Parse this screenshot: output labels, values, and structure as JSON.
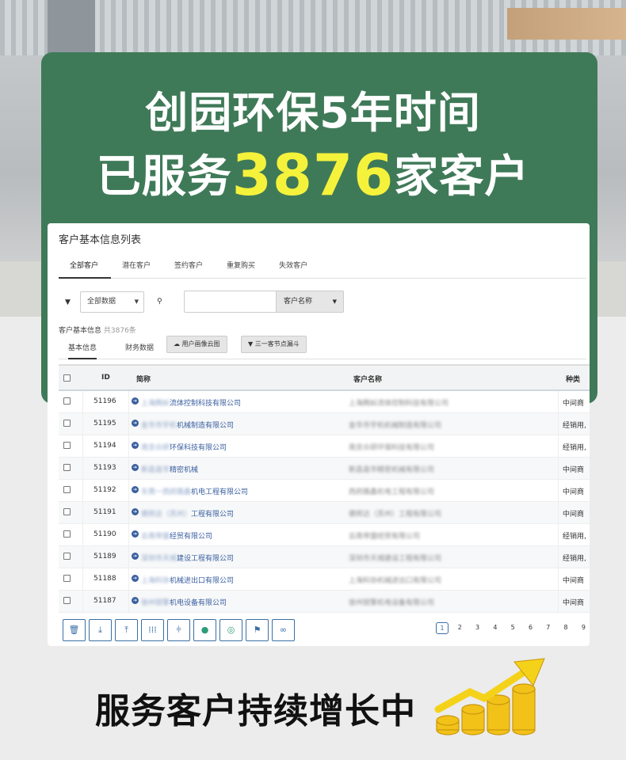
{
  "headline": {
    "line1": "创园环保5年时间",
    "line2_prefix": "已服务",
    "line2_number": "3876",
    "line2_suffix": "家客户"
  },
  "panel": {
    "title": "客户基本信息列表",
    "tabs": [
      "全部客户",
      "潜在客户",
      "签约客户",
      "重复购买",
      "失效客户"
    ],
    "active_tab": "全部客户",
    "filter": {
      "select_value": "全部数据",
      "search_placeholder": "",
      "search_field": "客户名称"
    },
    "info_label": "客户基本信息",
    "info_count": "共3876条",
    "subtabs": [
      "基本信息",
      "财务数据"
    ],
    "buttons": [
      "用户画像云图",
      "三一客节点漏斗"
    ],
    "table": {
      "headers": [
        "ID",
        "简称",
        "客户名称",
        "种类"
      ],
      "rows": [
        {
          "id": "51196",
          "short_blur": "上海腾蚪",
          "short": "流体控制科技有限公司",
          "full": "上海腾蚪流体控制科技有限公司",
          "type": "中间商"
        },
        {
          "id": "51195",
          "short_blur": "金华市宇机",
          "short": "机械制造有限公司",
          "full": "金华市宇机机械制造有限公司",
          "type": "经销用,"
        },
        {
          "id": "51194",
          "short_blur": "南京众研",
          "short": "环保科技有限公司",
          "full": "南京众研环保科技有限公司",
          "type": "经销用,"
        },
        {
          "id": "51193",
          "short_blur": "新昌县华",
          "short": "精密机械",
          "full": "新昌县华精密机械有限公司",
          "type": "中间商"
        },
        {
          "id": "51192",
          "short_blur": "东莞一西府路鑫",
          "short": "机电工程有限公司",
          "full": "西府路鑫机电工程有限公司",
          "type": "中间商"
        },
        {
          "id": "51191",
          "short_blur": "德邦达（苏州）",
          "short": "工程有限公司",
          "full": "德邦达（苏州）工程有限公司",
          "type": "中间商"
        },
        {
          "id": "51190",
          "short_blur": "云南帝盟",
          "short": "经贸有限公司",
          "full": "云南帝盟经贸有限公司",
          "type": "经销用,"
        },
        {
          "id": "51189",
          "short_blur": "深圳市天城",
          "short": "建设工程有限公司",
          "full": "深圳市天城建设工程有限公司",
          "type": "经销用,"
        },
        {
          "id": "51188",
          "short_blur": "上海科协",
          "short": "机械进出口有限公司",
          "full": "上海科协机械进出口有限公司",
          "type": "中间商"
        },
        {
          "id": "51187",
          "short_blur": "徐州锐擎",
          "short": "机电设备有限公司",
          "full": "徐州锐擎机电设备有限公司",
          "type": "中间商"
        }
      ]
    },
    "toolbar_icons": [
      "trash-icon",
      "download-icon",
      "upload-icon",
      "columns-icon",
      "align-icon",
      "chat-icon",
      "target-icon",
      "sitemap-icon",
      "link-icon"
    ],
    "pages": [
      "1",
      "2",
      "3",
      "4",
      "5",
      "6",
      "7",
      "8",
      "9"
    ],
    "current_page": "1"
  },
  "footer": {
    "text": "服务客户持续增长中"
  },
  "colors": {
    "banner_green": "#3f7a58",
    "highlight_yellow": "#f5f23c",
    "link_blue": "#3a5fa0",
    "coin_gold": "#f2c219"
  }
}
